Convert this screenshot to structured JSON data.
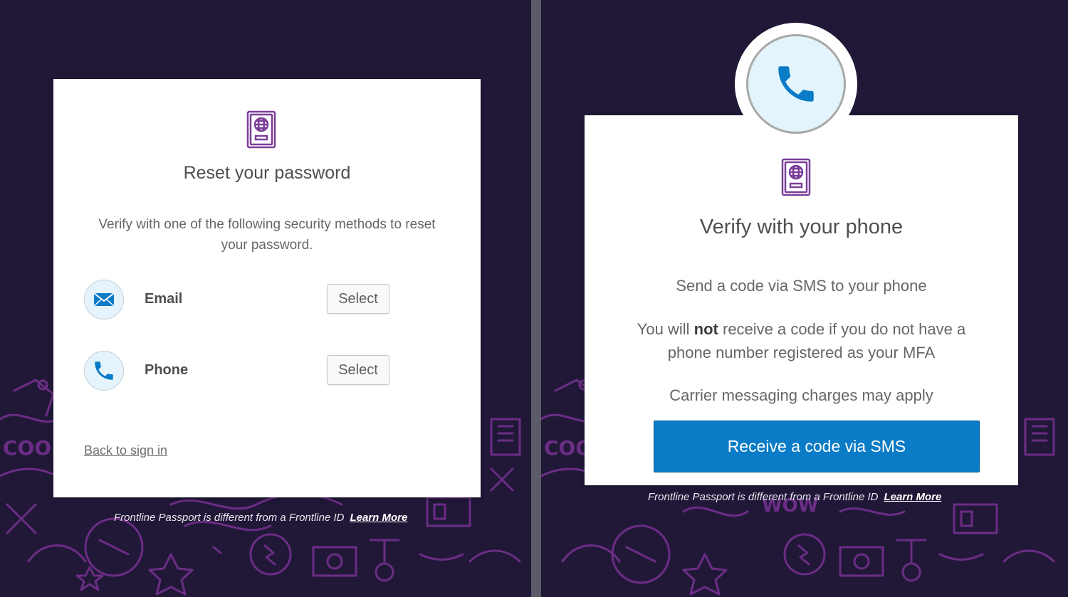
{
  "left": {
    "title": "Reset your password",
    "description": "Verify with one of the following security methods to reset your password.",
    "methods": [
      {
        "label": "Email",
        "button": "Select",
        "icon": "envelope-icon"
      },
      {
        "label": "Phone",
        "button": "Select",
        "icon": "phone-icon"
      }
    ],
    "back_link": "Back to sign in",
    "footer_text": "Frontline Passport is different from a Frontline ID",
    "footer_link": "Learn More"
  },
  "right": {
    "badge_icon": "phone-icon",
    "title": "Verify with your phone",
    "line1": "Send a code via SMS to your phone",
    "line2_pre": "You will ",
    "line2_bold": "not",
    "line2_post": " receive a code if you do not have a phone number registered as your MFA",
    "line3": "Carrier messaging charges may apply",
    "button": "Receive a code via SMS",
    "footer_text": "Frontline Passport is different from a Frontline ID",
    "footer_link": "Learn More"
  },
  "colors": {
    "background": "#211838",
    "doodle": "#6b2d85",
    "primary_button": "#0a7bc6",
    "icon_blue": "#0a7bc6",
    "passport_purple": "#7b3f98"
  }
}
